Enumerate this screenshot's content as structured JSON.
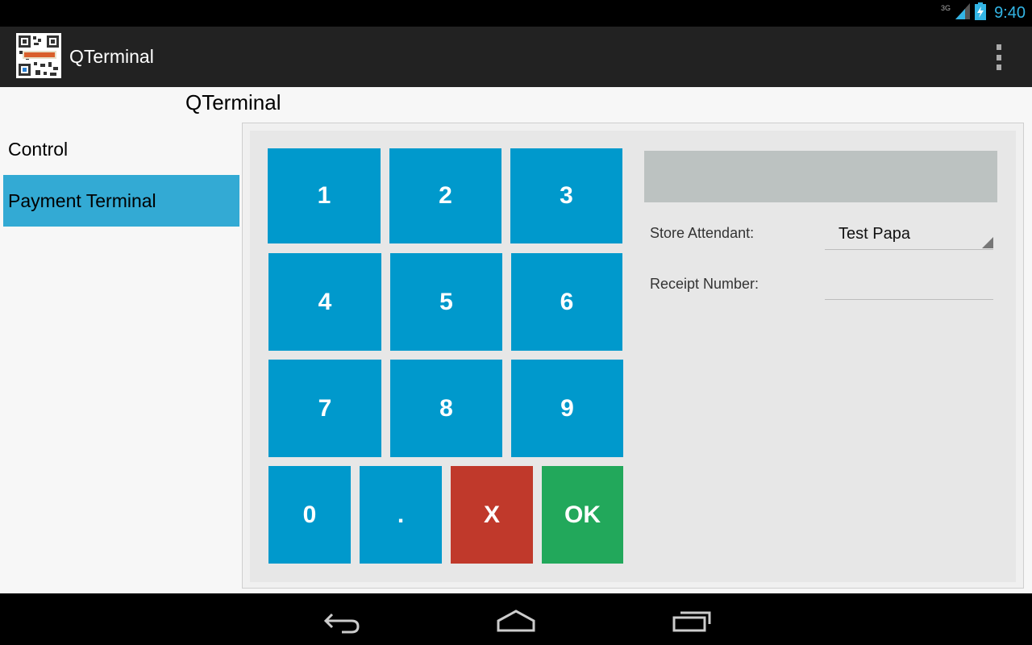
{
  "status_bar": {
    "network": "3G",
    "time": "9:40"
  },
  "action_bar": {
    "app_title": "QTerminal",
    "icon": "qr-code-app-icon",
    "menu_icon": "overflow-menu-icon"
  },
  "page": {
    "header_title": "QTerminal"
  },
  "sidebar": {
    "items": [
      {
        "label": "Control",
        "active": false
      },
      {
        "label": "Payment Terminal",
        "active": true
      }
    ]
  },
  "keypad": {
    "keys": [
      "1",
      "2",
      "3",
      "4",
      "5",
      "6",
      "7",
      "8",
      "9",
      "0",
      ".",
      "X",
      "OK"
    ],
    "colors": {
      "number": "#0099cc",
      "cancel": "#c0392b",
      "ok": "#22a85b"
    }
  },
  "form": {
    "amount_display": "",
    "store_attendant_label": "Store Attendant:",
    "store_attendant_value": "Test Papa",
    "receipt_number_label": "Receipt Number:",
    "receipt_number_value": ""
  },
  "nav_bar": {
    "icons": [
      "back-icon",
      "home-icon",
      "recent-apps-icon"
    ]
  },
  "colors": {
    "accent": "#33b5e5",
    "sidebar_active": "#33aad4"
  }
}
